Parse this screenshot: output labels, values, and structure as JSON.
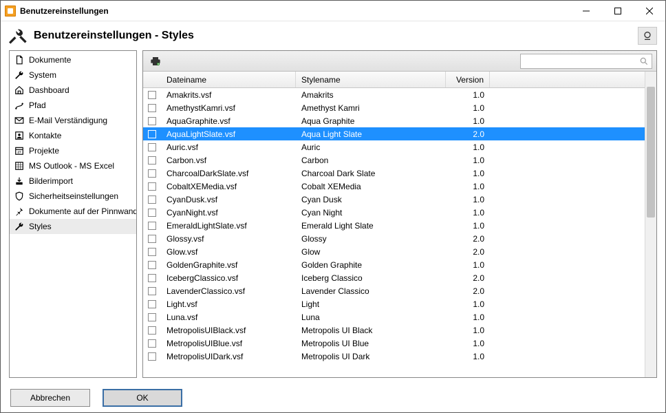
{
  "window": {
    "title": "Benutzereinstellungen"
  },
  "header": {
    "title": "Benutzereinstellungen - Styles"
  },
  "sidebar": {
    "items": [
      {
        "id": "dokumente",
        "label": "Dokumente",
        "icon": "document-icon"
      },
      {
        "id": "system",
        "label": "System",
        "icon": "wrench-icon"
      },
      {
        "id": "dashboard",
        "label": "Dashboard",
        "icon": "home-icon"
      },
      {
        "id": "pfad",
        "label": "Pfad",
        "icon": "path-icon"
      },
      {
        "id": "email",
        "label": "E-Mail Verständigung",
        "icon": "mail-icon"
      },
      {
        "id": "kontakte",
        "label": "Kontakte",
        "icon": "contact-icon"
      },
      {
        "id": "projekte",
        "label": "Projekte",
        "icon": "calendar-icon"
      },
      {
        "id": "outlook",
        "label": "MS Outlook - MS Excel",
        "icon": "grid-icon"
      },
      {
        "id": "bilderimport",
        "label": "Bilderimport",
        "icon": "import-icon"
      },
      {
        "id": "sicherheit",
        "label": "Sicherheitseinstellungen",
        "icon": "shield-icon"
      },
      {
        "id": "pinnwand",
        "label": "Dokumente auf der Pinnwand",
        "icon": "pin-icon"
      },
      {
        "id": "styles",
        "label": "Styles",
        "icon": "wrench-icon"
      }
    ],
    "selected": "styles"
  },
  "table": {
    "columns": {
      "filename": "Dateiname",
      "stylename": "Stylename",
      "version": "Version"
    },
    "selected_index": 3,
    "rows": [
      {
        "filename": "Amakrits.vsf",
        "stylename": "Amakrits",
        "version": "1.0"
      },
      {
        "filename": "AmethystKamri.vsf",
        "stylename": "Amethyst Kamri",
        "version": "1.0"
      },
      {
        "filename": "AquaGraphite.vsf",
        "stylename": "Aqua Graphite",
        "version": "1.0"
      },
      {
        "filename": "AquaLightSlate.vsf",
        "stylename": "Aqua Light Slate",
        "version": "2.0"
      },
      {
        "filename": "Auric.vsf",
        "stylename": "Auric",
        "version": "1.0"
      },
      {
        "filename": "Carbon.vsf",
        "stylename": "Carbon",
        "version": "1.0"
      },
      {
        "filename": "CharcoalDarkSlate.vsf",
        "stylename": "Charcoal Dark Slate",
        "version": "1.0"
      },
      {
        "filename": "CobaltXEMedia.vsf",
        "stylename": "Cobalt XEMedia",
        "version": "1.0"
      },
      {
        "filename": "CyanDusk.vsf",
        "stylename": "Cyan Dusk",
        "version": "1.0"
      },
      {
        "filename": "CyanNight.vsf",
        "stylename": "Cyan Night",
        "version": "1.0"
      },
      {
        "filename": "EmeraldLightSlate.vsf",
        "stylename": "Emerald Light Slate",
        "version": "1.0"
      },
      {
        "filename": "Glossy.vsf",
        "stylename": "Glossy",
        "version": "2.0"
      },
      {
        "filename": "Glow.vsf",
        "stylename": "Glow",
        "version": "2.0"
      },
      {
        "filename": "GoldenGraphite.vsf",
        "stylename": "Golden Graphite",
        "version": "1.0"
      },
      {
        "filename": "IcebergClassico.vsf",
        "stylename": "Iceberg Classico",
        "version": "2.0"
      },
      {
        "filename": "LavenderClassico.vsf",
        "stylename": "Lavender Classico",
        "version": "2.0"
      },
      {
        "filename": "Light.vsf",
        "stylename": "Light",
        "version": "1.0"
      },
      {
        "filename": "Luna.vsf",
        "stylename": "Luna",
        "version": "1.0"
      },
      {
        "filename": "MetropolisUIBlack.vsf",
        "stylename": "Metropolis UI Black",
        "version": "1.0"
      },
      {
        "filename": "MetropolisUIBlue.vsf",
        "stylename": "Metropolis UI Blue",
        "version": "1.0"
      },
      {
        "filename": "MetropolisUIDark.vsf",
        "stylename": "Metropolis UI Dark",
        "version": "1.0"
      }
    ]
  },
  "search": {
    "value": "",
    "placeholder": ""
  },
  "footer": {
    "cancel": "Abbrechen",
    "ok": "OK"
  }
}
